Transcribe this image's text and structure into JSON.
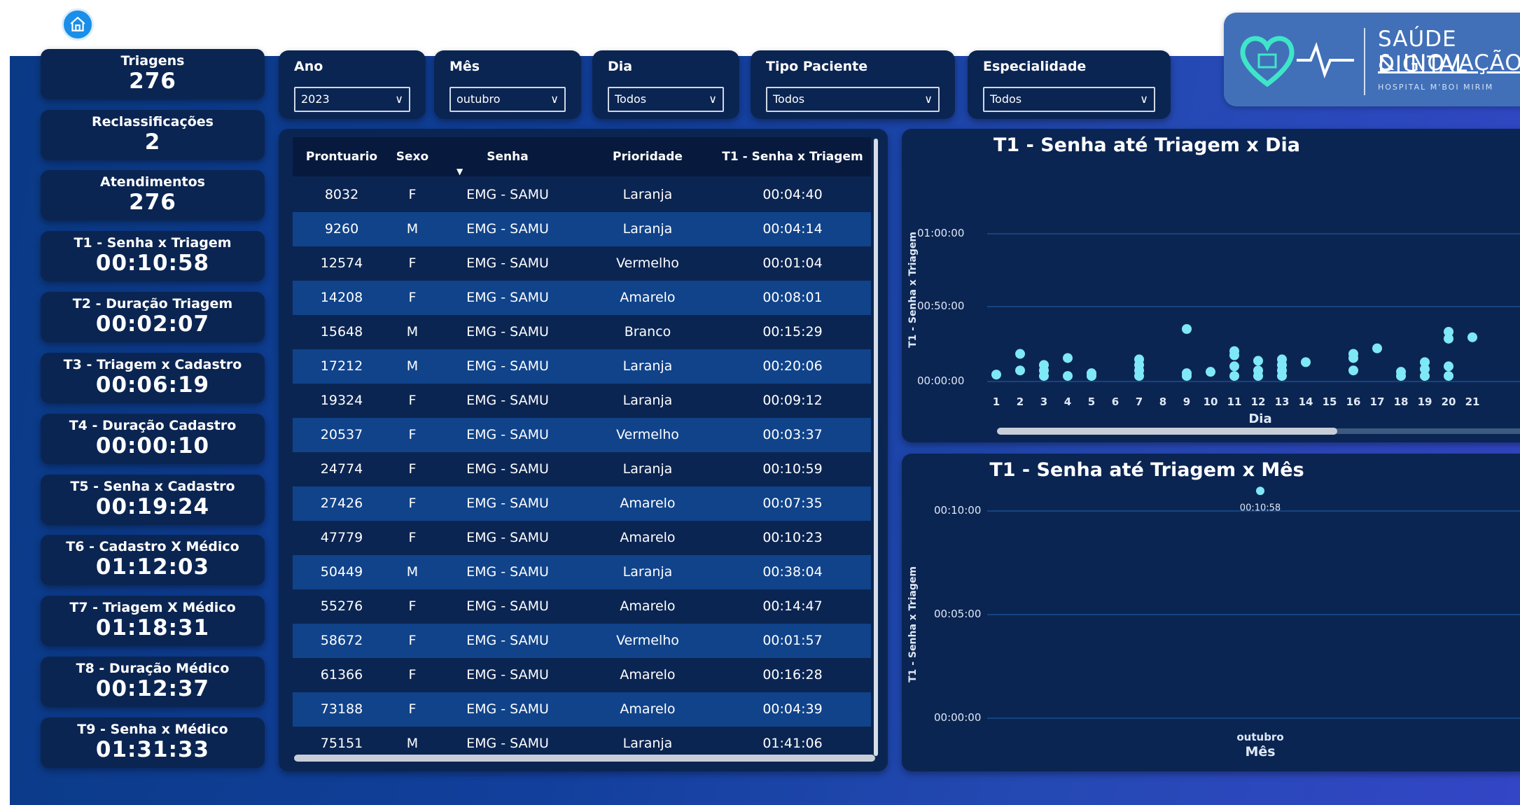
{
  "nav": {
    "home_icon": "home-icon"
  },
  "kpis": [
    {
      "title": "Triagens",
      "value": "276"
    },
    {
      "title": "Reclassificações",
      "value": "2"
    },
    {
      "title": "Atendimentos",
      "value": "276"
    },
    {
      "title": "T1 - Senha x Triagem",
      "value": "00:10:58"
    },
    {
      "title": "T2 - Duração Triagem",
      "value": "00:02:07"
    },
    {
      "title": "T3 - Triagem x Cadastro",
      "value": "00:06:19"
    },
    {
      "title": "T4 - Duração Cadastro",
      "value": "00:00:10"
    },
    {
      "title": "T5 - Senha x Cadastro",
      "value": "00:19:24"
    },
    {
      "title": "T6 - Cadastro X Médico",
      "value": "01:12:03"
    },
    {
      "title": "T7 - Triagem X Médico",
      "value": "01:18:31"
    },
    {
      "title": "T8 - Duração Médico",
      "value": "00:12:37"
    },
    {
      "title": "T9 - Senha x Médico",
      "value": "01:31:33"
    }
  ],
  "filters": [
    {
      "label": "Ano",
      "value": "2023"
    },
    {
      "label": "Mês",
      "value": "outubro"
    },
    {
      "label": "Dia",
      "value": "Todos"
    },
    {
      "label": "Tipo Paciente",
      "value": "Todos"
    },
    {
      "label": "Especialidade",
      "value": "Todos"
    }
  ],
  "logo": {
    "line1": "SAÚDE DIGITAL",
    "line2": "& INOVAÇÃO",
    "line3": "HOSPITAL M'BOI MIRIM"
  },
  "table": {
    "headers": [
      "Prontuario",
      "Sexo",
      "Senha",
      "Prioridade",
      "T1 - Senha x Triagem"
    ],
    "rows": [
      [
        "8032",
        "F",
        "EMG - SAMU",
        "Laranja",
        "00:04:40"
      ],
      [
        "9260",
        "M",
        "EMG - SAMU",
        "Laranja",
        "00:04:14"
      ],
      [
        "12574",
        "F",
        "EMG - SAMU",
        "Vermelho",
        "00:01:04"
      ],
      [
        "14208",
        "F",
        "EMG - SAMU",
        "Amarelo",
        "00:08:01"
      ],
      [
        "15648",
        "M",
        "EMG - SAMU",
        "Branco",
        "00:15:29"
      ],
      [
        "17212",
        "M",
        "EMG - SAMU",
        "Laranja",
        "00:20:06"
      ],
      [
        "19324",
        "F",
        "EMG - SAMU",
        "Laranja",
        "00:09:12"
      ],
      [
        "20537",
        "F",
        "EMG - SAMU",
        "Vermelho",
        "00:03:37"
      ],
      [
        "24774",
        "F",
        "EMG - SAMU",
        "Laranja",
        "00:10:59"
      ],
      [
        "27426",
        "F",
        "EMG - SAMU",
        "Amarelo",
        "00:07:35"
      ],
      [
        "47779",
        "F",
        "EMG - SAMU",
        "Amarelo",
        "00:10:23"
      ],
      [
        "50449",
        "M",
        "EMG - SAMU",
        "Laranja",
        "00:38:04"
      ],
      [
        "55276",
        "F",
        "EMG - SAMU",
        "Amarelo",
        "00:14:47"
      ],
      [
        "58672",
        "F",
        "EMG - SAMU",
        "Vermelho",
        "00:01:57"
      ],
      [
        "61366",
        "F",
        "EMG - SAMU",
        "Amarelo",
        "00:16:28"
      ],
      [
        "73188",
        "F",
        "EMG - SAMU",
        "Amarelo",
        "00:04:39"
      ],
      [
        "75151",
        "M",
        "EMG - SAMU",
        "Laranja",
        "01:41:06"
      ]
    ]
  },
  "chart_data": [
    {
      "type": "scatter",
      "title": "T1 - Senha até Triagem x Dia",
      "xlabel": "Dia",
      "ylabel": "T1 - Senha x Triagem",
      "y_ticks": [
        "00:00:00",
        "00:50:00",
        "01:00:00"
      ],
      "x_ticks": [
        "1",
        "2",
        "3",
        "4",
        "5",
        "6",
        "7",
        "8",
        "9",
        "10",
        "11",
        "12",
        "13",
        "14",
        "15",
        "16",
        "17",
        "18",
        "19",
        "20",
        "21"
      ],
      "y_unit": "minutes",
      "points": [
        {
          "x": 1,
          "y": 5
        },
        {
          "x": 2,
          "y": 8
        },
        {
          "x": 2,
          "y": 20
        },
        {
          "x": 3,
          "y": 4
        },
        {
          "x": 3,
          "y": 8
        },
        {
          "x": 3,
          "y": 12
        },
        {
          "x": 4,
          "y": 4
        },
        {
          "x": 4,
          "y": 17
        },
        {
          "x": 5,
          "y": 4
        },
        {
          "x": 5,
          "y": 6
        },
        {
          "x": 7,
          "y": 4
        },
        {
          "x": 7,
          "y": 8
        },
        {
          "x": 7,
          "y": 12
        },
        {
          "x": 7,
          "y": 16
        },
        {
          "x": 9,
          "y": 4
        },
        {
          "x": 9,
          "y": 6
        },
        {
          "x": 9,
          "y": 38
        },
        {
          "x": 10,
          "y": 7
        },
        {
          "x": 11,
          "y": 4
        },
        {
          "x": 11,
          "y": 11
        },
        {
          "x": 11,
          "y": 19
        },
        {
          "x": 11,
          "y": 22
        },
        {
          "x": 12,
          "y": 4
        },
        {
          "x": 12,
          "y": 8
        },
        {
          "x": 12,
          "y": 15
        },
        {
          "x": 13,
          "y": 4
        },
        {
          "x": 13,
          "y": 8
        },
        {
          "x": 13,
          "y": 12
        },
        {
          "x": 13,
          "y": 16
        },
        {
          "x": 14,
          "y": 14
        },
        {
          "x": 16,
          "y": 8
        },
        {
          "x": 16,
          "y": 17
        },
        {
          "x": 16,
          "y": 20
        },
        {
          "x": 17,
          "y": 24
        },
        {
          "x": 18,
          "y": 4
        },
        {
          "x": 18,
          "y": 7
        },
        {
          "x": 19,
          "y": 4
        },
        {
          "x": 19,
          "y": 9
        },
        {
          "x": 19,
          "y": 14
        },
        {
          "x": 20,
          "y": 4
        },
        {
          "x": 20,
          "y": 11
        },
        {
          "x": 20,
          "y": 31
        },
        {
          "x": 20,
          "y": 36
        },
        {
          "x": 21,
          "y": 32
        }
      ],
      "scrollbar": true
    },
    {
      "type": "scatter",
      "title": "T1 - Senha até Triagem x Mês",
      "xlabel": "Mês",
      "ylabel": "T1 - Senha x Triagem",
      "y_ticks": [
        "00:00:00",
        "00:05:00",
        "00:10:00"
      ],
      "categories": [
        "outubro"
      ],
      "y_unit": "minutes",
      "points": [
        {
          "x": "outubro",
          "y": 10.97,
          "label": "00:10:58"
        }
      ]
    }
  ]
}
